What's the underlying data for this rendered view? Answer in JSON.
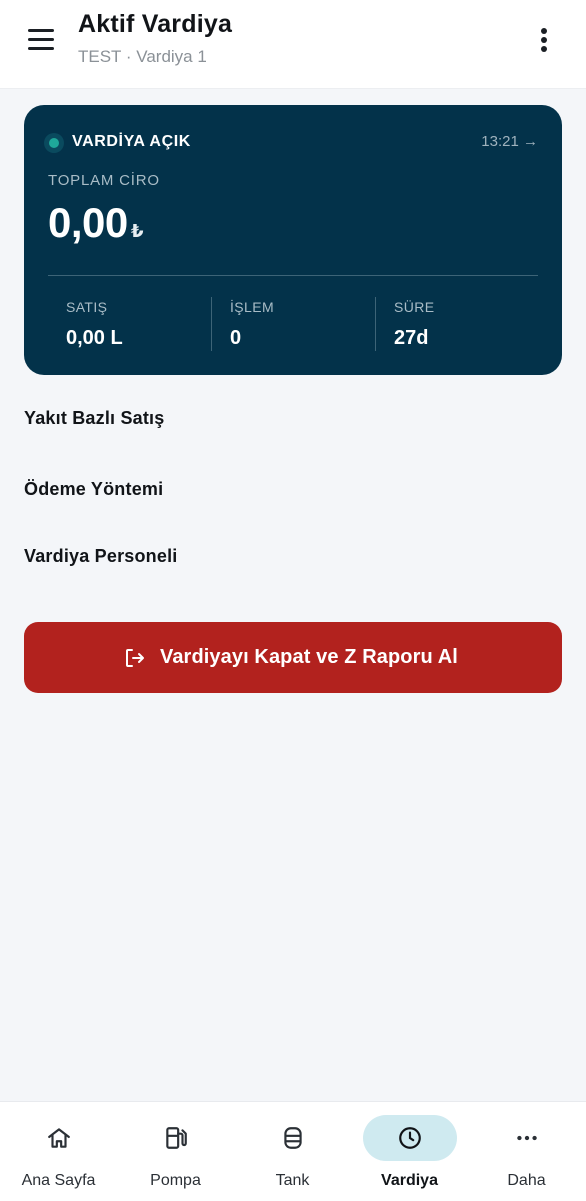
{
  "header": {
    "title": "Aktif Vardiya",
    "subtitle": "TEST · Vardiya 1",
    "menu_icon": "hamburger-menu-icon",
    "more_icon": "more-vertical-icon"
  },
  "summary_card": {
    "status": "VARDİYA AÇIK",
    "start_time": "13:21 →",
    "revenue_label": "TOPLAM CİRO",
    "revenue_value": "0,00",
    "currency_symbol": "₺",
    "stats": [
      {
        "label": "SATIŞ",
        "value": "0,00 L"
      },
      {
        "label": "İŞLEM",
        "value": "0"
      },
      {
        "label": "SÜRE",
        "value": "27d"
      }
    ],
    "background_color": "#03324a",
    "status_color": "#1fa89a"
  },
  "sections": {
    "fuel_sales": "Yakıt Bazlı Satış",
    "payment_method": "Ödeme Yöntemi",
    "shift_staff": "Vardiya Personeli"
  },
  "close_button": {
    "label": "Vardiyayı Kapat ve Z Raporu Al",
    "icon": "logout-icon",
    "color": "#b2221e"
  },
  "bottom_nav": {
    "items": [
      {
        "label": "Ana Sayfa",
        "icon": "home-icon"
      },
      {
        "label": "Pompa",
        "icon": "fuel-pump-icon"
      },
      {
        "label": "Tank",
        "icon": "tank-icon"
      },
      {
        "label": "Vardiya",
        "icon": "clock-icon"
      },
      {
        "label": "Daha",
        "icon": "more-horizontal-icon"
      }
    ],
    "active": "Vardiya",
    "active_color": "#cfeaf0"
  }
}
